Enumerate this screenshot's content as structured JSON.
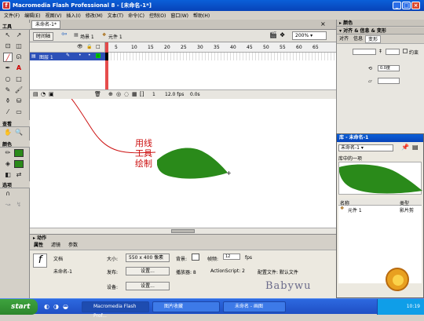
{
  "window": {
    "title": "Macromedia Flash Professional 8 - [未命名-1*]"
  },
  "menu": [
    "文件(F)",
    "编辑(E)",
    "视图(V)",
    "插入(I)",
    "修改(M)",
    "文本(T)",
    "命令(C)",
    "控制(O)",
    "窗口(W)",
    "帮助(H)"
  ],
  "tools": {
    "header": "工具",
    "view_header": "查看",
    "color_header": "颜色",
    "options_header": "选项"
  },
  "document": {
    "tab": "未命名-1*",
    "timeline_button": "时间轴",
    "scene": "场景 1",
    "symbol": "元件 1",
    "zoom": "200%"
  },
  "timeline": {
    "layer_name": "图层 1",
    "frame_numbers": [
      "5",
      "10",
      "15",
      "20",
      "25",
      "30",
      "35",
      "40",
      "45",
      "50",
      "55",
      "60",
      "65"
    ],
    "current_frame": "1",
    "fps": "12.0 fps",
    "time": "0.0s"
  },
  "annotation": {
    "lines": [
      "用线",
      "工具",
      "绘制"
    ],
    "color": "#cc1010"
  },
  "leaf": {
    "fill": "#2a8a1a"
  },
  "panels": {
    "actions": "动作",
    "properties_tabs": [
      "属性",
      "滤镜",
      "参数"
    ]
  },
  "properties": {
    "doc_label": "文档",
    "doc_name": "未命名-1",
    "size_label": "大小:",
    "size_value": "550 x 400 像素",
    "background_label": "背景:",
    "framerate_label": "帧频:",
    "framerate_value": "12",
    "fps_unit": "fps",
    "publish_label": "发布:",
    "settings_btn": "设置...",
    "player_label": "播放器: 8",
    "actionscript_label": "ActionScript: 2",
    "profile_label": "配置文件: 默认文件",
    "device_label": "设备:",
    "device_btn": "设置..."
  },
  "right": {
    "color": "颜色",
    "align_info": "对齐 & 信息 & 变形",
    "align_tabs": [
      "对齐",
      "信息",
      "变形"
    ],
    "constrain": "约束",
    "w_value": "0.0度"
  },
  "library": {
    "title": "库 - 未命名-1",
    "doc": "未命名-1",
    "items_count": "库中的一项",
    "col_name": "名称",
    "col_type": "类型",
    "item_name": "元件 1",
    "item_type": "影片剪"
  },
  "watermark": "Babywu",
  "taskbar": {
    "start": "start",
    "tasks": [
      "Macromedia Flash Prof...",
      "图片收藏",
      "未命名 - 画图"
    ],
    "clock": "10:19"
  }
}
